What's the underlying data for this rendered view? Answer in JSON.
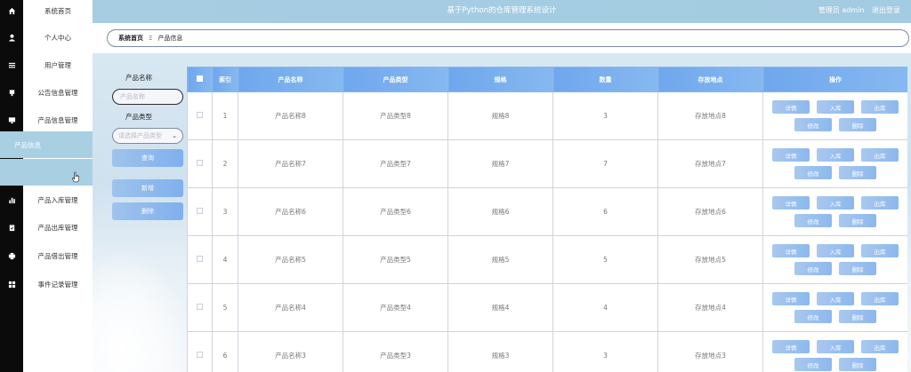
{
  "header": {
    "title": "基于Python的仓库管理系统设计",
    "user_label": "管理员 admin",
    "logout": "退出登录"
  },
  "breadcrumb": {
    "home": "系统首页",
    "separator": "Ξ",
    "current": "产品信息"
  },
  "menu": [
    {
      "label": "系统首页",
      "icon": "home-icon"
    },
    {
      "label": "个人中心",
      "icon": "user-icon"
    },
    {
      "label": "用户管理",
      "icon": "list-icon"
    },
    {
      "label": "公告信息管理",
      "icon": "notice-icon"
    },
    {
      "label": "产品信息管理",
      "icon": "monitor-icon"
    },
    {
      "label": "产品信息",
      "icon": ""
    },
    {
      "label": "",
      "icon": "sliders-icon"
    },
    {
      "label": "产品入库管理",
      "icon": "bar-chart-icon"
    },
    {
      "label": "产品出库管理",
      "icon": "clipboard-icon"
    },
    {
      "label": "产品借出管理",
      "icon": "printer-icon"
    },
    {
      "label": "事件记录管理",
      "icon": "grid-icon"
    }
  ],
  "search": {
    "name_label": "产品名称",
    "name_placeholder": "产品名称",
    "type_label": "产品类型",
    "type_placeholder": "请选择产品类型",
    "query_button": "查询",
    "add_button": "新增",
    "delete_button": "删除"
  },
  "table": {
    "headers": [
      "索引",
      "产品名称",
      "产品类型",
      "规格",
      "数量",
      "存放地点",
      "操作"
    ],
    "rows": [
      {
        "index": "1",
        "name": "产品名称8",
        "type": "产品类型8",
        "spec": "规格8",
        "qty": "3",
        "location": "存放地点8"
      },
      {
        "index": "2",
        "name": "产品名称7",
        "type": "产品类型7",
        "spec": "规格7",
        "qty": "7",
        "location": "存放地点7"
      },
      {
        "index": "3",
        "name": "产品名称6",
        "type": "产品类型6",
        "spec": "规格6",
        "qty": "6",
        "location": "存放地点6"
      },
      {
        "index": "4",
        "name": "产品名称5",
        "type": "产品类型5",
        "spec": "规格5",
        "qty": "5",
        "location": "存放地点5"
      },
      {
        "index": "5",
        "name": "产品名称4",
        "type": "产品类型4",
        "spec": "规格4",
        "qty": "4",
        "location": "存放地点4"
      },
      {
        "index": "6",
        "name": "产品名称3",
        "type": "产品类型3",
        "spec": "规格3",
        "qty": "3",
        "location": "存放地点3"
      }
    ],
    "actions": {
      "detail": "详情",
      "stock_in": "入库",
      "stock_out": "出库",
      "edit": "修改",
      "delete": "删除"
    }
  },
  "colors": {
    "header_bg": "#a6cde2",
    "table_header": "#6fa7ee",
    "button": "#8cb8ee",
    "sidebar_dark": "#0b0b0b",
    "menu_active": "#a9cfe3"
  }
}
